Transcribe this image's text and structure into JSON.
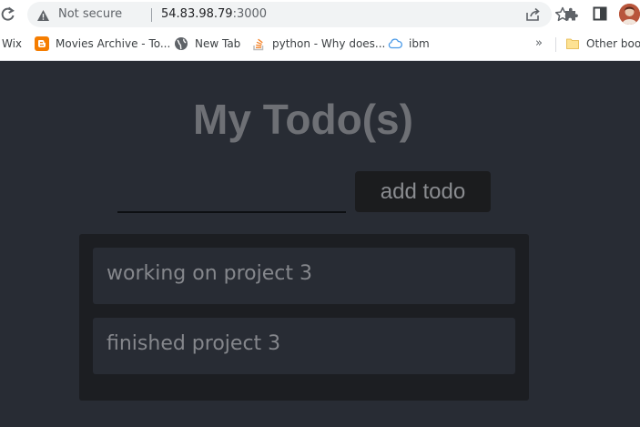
{
  "browser": {
    "security_label": "Not secure",
    "url_host": "54.83.98.79",
    "url_port": ":3000",
    "bookmarks": [
      {
        "label": "Wix",
        "icon": "none"
      },
      {
        "label": "Movies Archive - To...",
        "icon": "blogger-icon"
      },
      {
        "label": "New Tab",
        "icon": "globe-icon"
      },
      {
        "label": "python - Why does...",
        "icon": "stackoverflow-icon"
      },
      {
        "label": "ibm",
        "icon": "cloud-icon"
      }
    ],
    "more_bookmarks": "»",
    "other_bookmarks": "Other book"
  },
  "app": {
    "title": "My Todo(s)",
    "input_value": "",
    "add_button_label": "add todo",
    "todos": [
      {
        "text": "working on project 3"
      },
      {
        "text": "finished project 3"
      }
    ]
  },
  "colors": {
    "background": "#282c34",
    "list_bg": "#1c1e22",
    "button_bg": "#1b1c1e",
    "title": "#6e7075"
  }
}
